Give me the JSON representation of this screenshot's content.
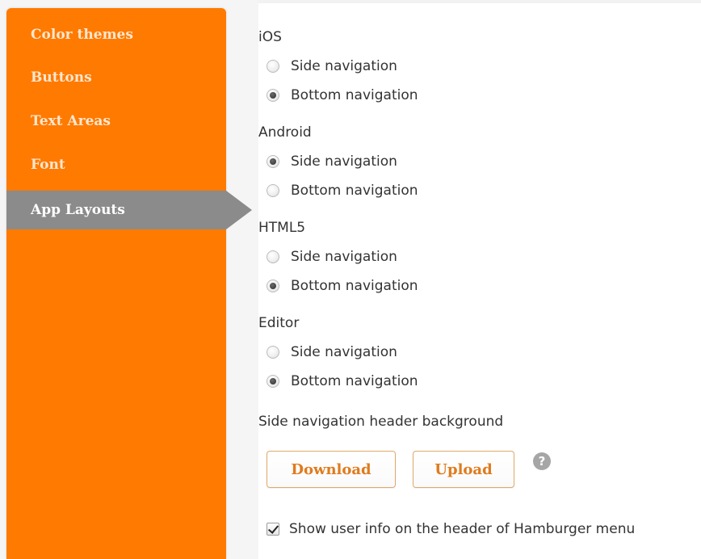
{
  "sidebar": {
    "items": [
      {
        "label": "Color themes"
      },
      {
        "label": "Buttons"
      },
      {
        "label": "Text Areas"
      },
      {
        "label": "Font"
      },
      {
        "label": "App Layouts"
      }
    ],
    "active": "App Layouts"
  },
  "layouts": [
    {
      "title": "iOS",
      "options": [
        {
          "label": "Side navigation",
          "checked": false
        },
        {
          "label": "Bottom navigation",
          "checked": true
        }
      ]
    },
    {
      "title": "Android",
      "options": [
        {
          "label": "Side navigation",
          "checked": true
        },
        {
          "label": "Bottom navigation",
          "checked": false
        }
      ]
    },
    {
      "title": "HTML5",
      "options": [
        {
          "label": "Side navigation",
          "checked": false
        },
        {
          "label": "Bottom navigation",
          "checked": true
        }
      ]
    },
    {
      "title": "Editor",
      "options": [
        {
          "label": "Side navigation",
          "checked": false
        },
        {
          "label": "Bottom navigation",
          "checked": true
        }
      ]
    }
  ],
  "header_background": {
    "label": "Side navigation header background",
    "download_label": "Download",
    "upload_label": "Upload",
    "help_symbol": "?"
  },
  "show_user_info": {
    "label": "Show user info on the header of Hamburger menu",
    "checked": true
  },
  "colors": {
    "sidebar": "#ff7a00",
    "active_item": "#8b8b8b",
    "button_text": "#e07b1d"
  }
}
